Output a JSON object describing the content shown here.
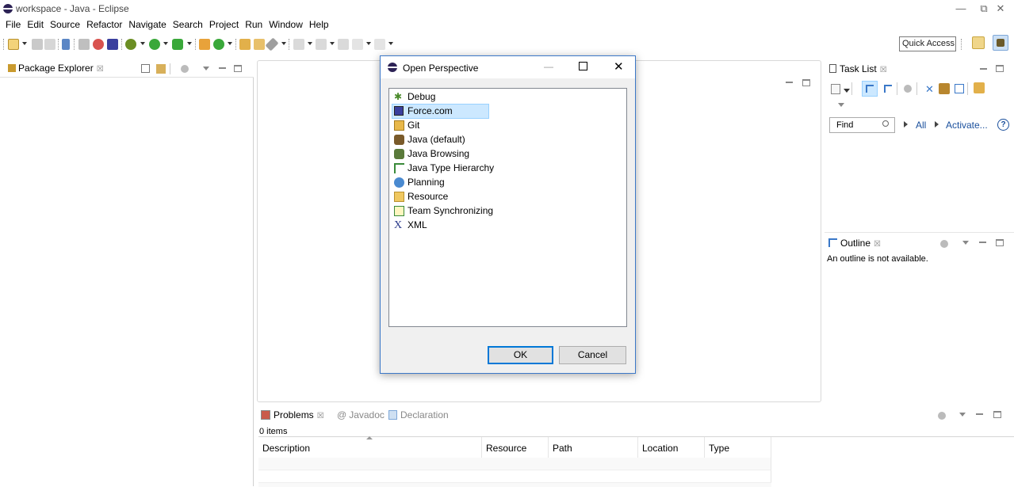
{
  "window": {
    "title": "workspace - Java - Eclipse",
    "controls": {
      "minimize": "—",
      "restore": "⧉",
      "close": "✕"
    }
  },
  "menubar": [
    "File",
    "Edit",
    "Source",
    "Refactor",
    "Navigate",
    "Search",
    "Project",
    "Run",
    "Window",
    "Help"
  ],
  "toolbar": {
    "quick_access_label": "Quick Access"
  },
  "package_explorer": {
    "tab_label": "Package Explorer",
    "close_glyph": "☒"
  },
  "task_list": {
    "tab_label": "Task List",
    "close_glyph": "☒",
    "find_placeholder": "Find",
    "all_label": "All",
    "activate_label": "Activate...",
    "help_glyph": "?"
  },
  "outline": {
    "tab_label": "Outline",
    "close_glyph": "☒",
    "message": "An outline is not available."
  },
  "bottom_panel": {
    "tabs": [
      {
        "label": "Problems",
        "active": true
      },
      {
        "label": "Javadoc",
        "active": false
      },
      {
        "label": "Declaration",
        "active": false
      }
    ],
    "close_glyph": "☒",
    "item_count": "0 items",
    "columns": [
      "Description",
      "Resource",
      "Path",
      "Location",
      "Type"
    ]
  },
  "dialog": {
    "title": "Open Perspective",
    "perspectives": [
      {
        "label": "Debug",
        "icon": "debug-bug-icon",
        "selected": false
      },
      {
        "label": "Force.com",
        "icon": "force-com-icon",
        "selected": true
      },
      {
        "label": "Git",
        "icon": "git-icon",
        "selected": false
      },
      {
        "label": "Java (default)",
        "icon": "java-perspective-icon",
        "selected": false
      },
      {
        "label": "Java Browsing",
        "icon": "java-browsing-icon",
        "selected": false
      },
      {
        "label": "Java Type Hierarchy",
        "icon": "type-hierarchy-icon",
        "selected": false
      },
      {
        "label": "Planning",
        "icon": "planning-clock-icon",
        "selected": false
      },
      {
        "label": "Resource",
        "icon": "resource-folder-icon",
        "selected": false
      },
      {
        "label": "Team Synchronizing",
        "icon": "team-sync-icon",
        "selected": false
      },
      {
        "label": "XML",
        "icon": "xml-icon",
        "selected": false
      }
    ],
    "ok_label": "OK",
    "cancel_label": "Cancel",
    "controls": {
      "minimize": "—",
      "maximize": "☐",
      "close": "✕"
    }
  },
  "colors": {
    "selection": "#cce8ff",
    "dialog_border": "#3c78c8",
    "link_blue": "#1a4f9c"
  }
}
